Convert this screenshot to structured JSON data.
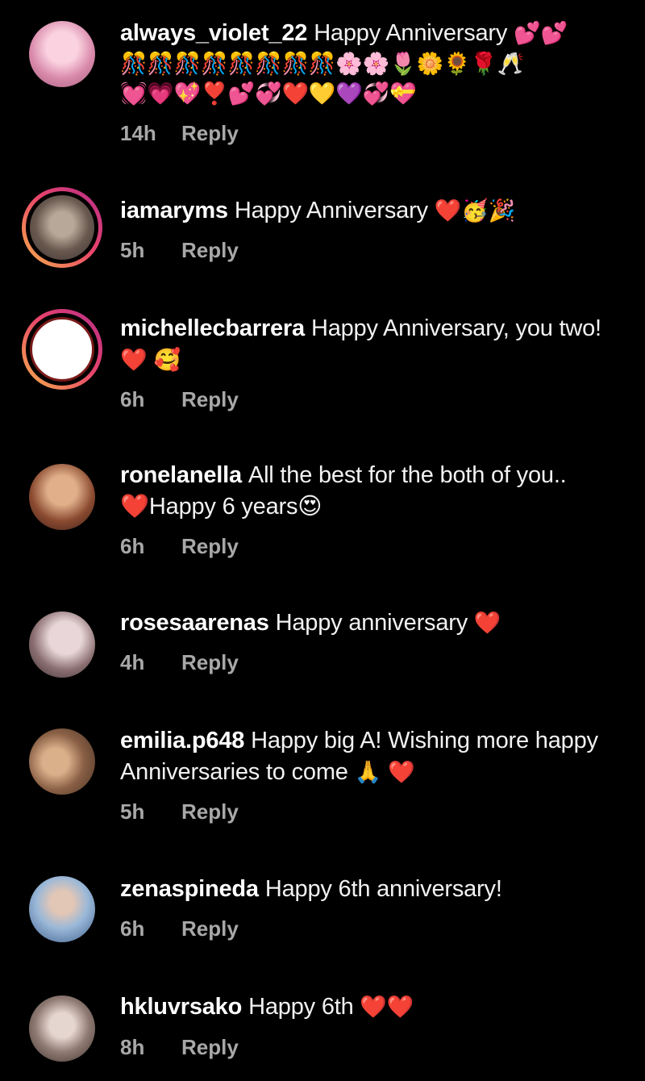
{
  "comments": [
    {
      "username": "always_violet_22",
      "text": "Happy Anniversary",
      "emojis": "💕💕",
      "emoji_line_2": "🎊🎊🎊🎊🎊🎊🎊🎊🌸🌸🌷🌼🌻🌹🥂",
      "emoji_line_3": "💓💗💖❣️💕💞❤️💛💜💞💝",
      "time": "14h",
      "reply": "Reply",
      "avatar_colors": [
        "#f3c6d6",
        "#c97a99"
      ]
    },
    {
      "username": "iamaryms",
      "text": "Happy Anniversary",
      "emojis": "❤️🥳🎉",
      "time": "5h",
      "reply": "Reply",
      "avatar_colors": [
        "#8b8b8b",
        "#4d4d4d"
      ]
    },
    {
      "username": "michellecbarrera",
      "text": "Happy Anniversary, you two!",
      "emojis": "❤️ 🥰",
      "time": "6h",
      "reply": "Reply",
      "avatar_colors": [
        "#ffffff",
        "#7a1a1a"
      ]
    },
    {
      "username": "ronelanella",
      "text": "All the best for the both of you..",
      "text_line_2": "❤️Happy 6 years😍",
      "time": "6h",
      "reply": "Reply",
      "avatar_colors": [
        "#d9a07a",
        "#5a2a20"
      ]
    },
    {
      "username": "rosesaarenas",
      "text": "Happy anniversary",
      "emojis": "❤️",
      "time": "4h",
      "reply": "Reply",
      "avatar_colors": [
        "#d8c2c6",
        "#4b3a3c"
      ]
    },
    {
      "username": "emilia.p648",
      "text": "Happy big A! Wishing more happy Anniversaries to come",
      "emojis": "🙏 ❤️",
      "time": "5h",
      "reply": "Reply",
      "avatar_colors": [
        "#c9a27e",
        "#6b4a36"
      ]
    },
    {
      "username": "zenaspineda",
      "text": "Happy 6th anniversary!",
      "time": "6h",
      "reply": "Reply",
      "avatar_colors": [
        "#cfe3f5",
        "#2e4c7a"
      ]
    },
    {
      "username": "hkluvrsako",
      "text": "Happy 6th",
      "emojis": "❤️❤️",
      "time": "8h",
      "reply": "Reply",
      "avatar_colors": [
        "#d2c3bd",
        "#5e4c46"
      ]
    }
  ]
}
